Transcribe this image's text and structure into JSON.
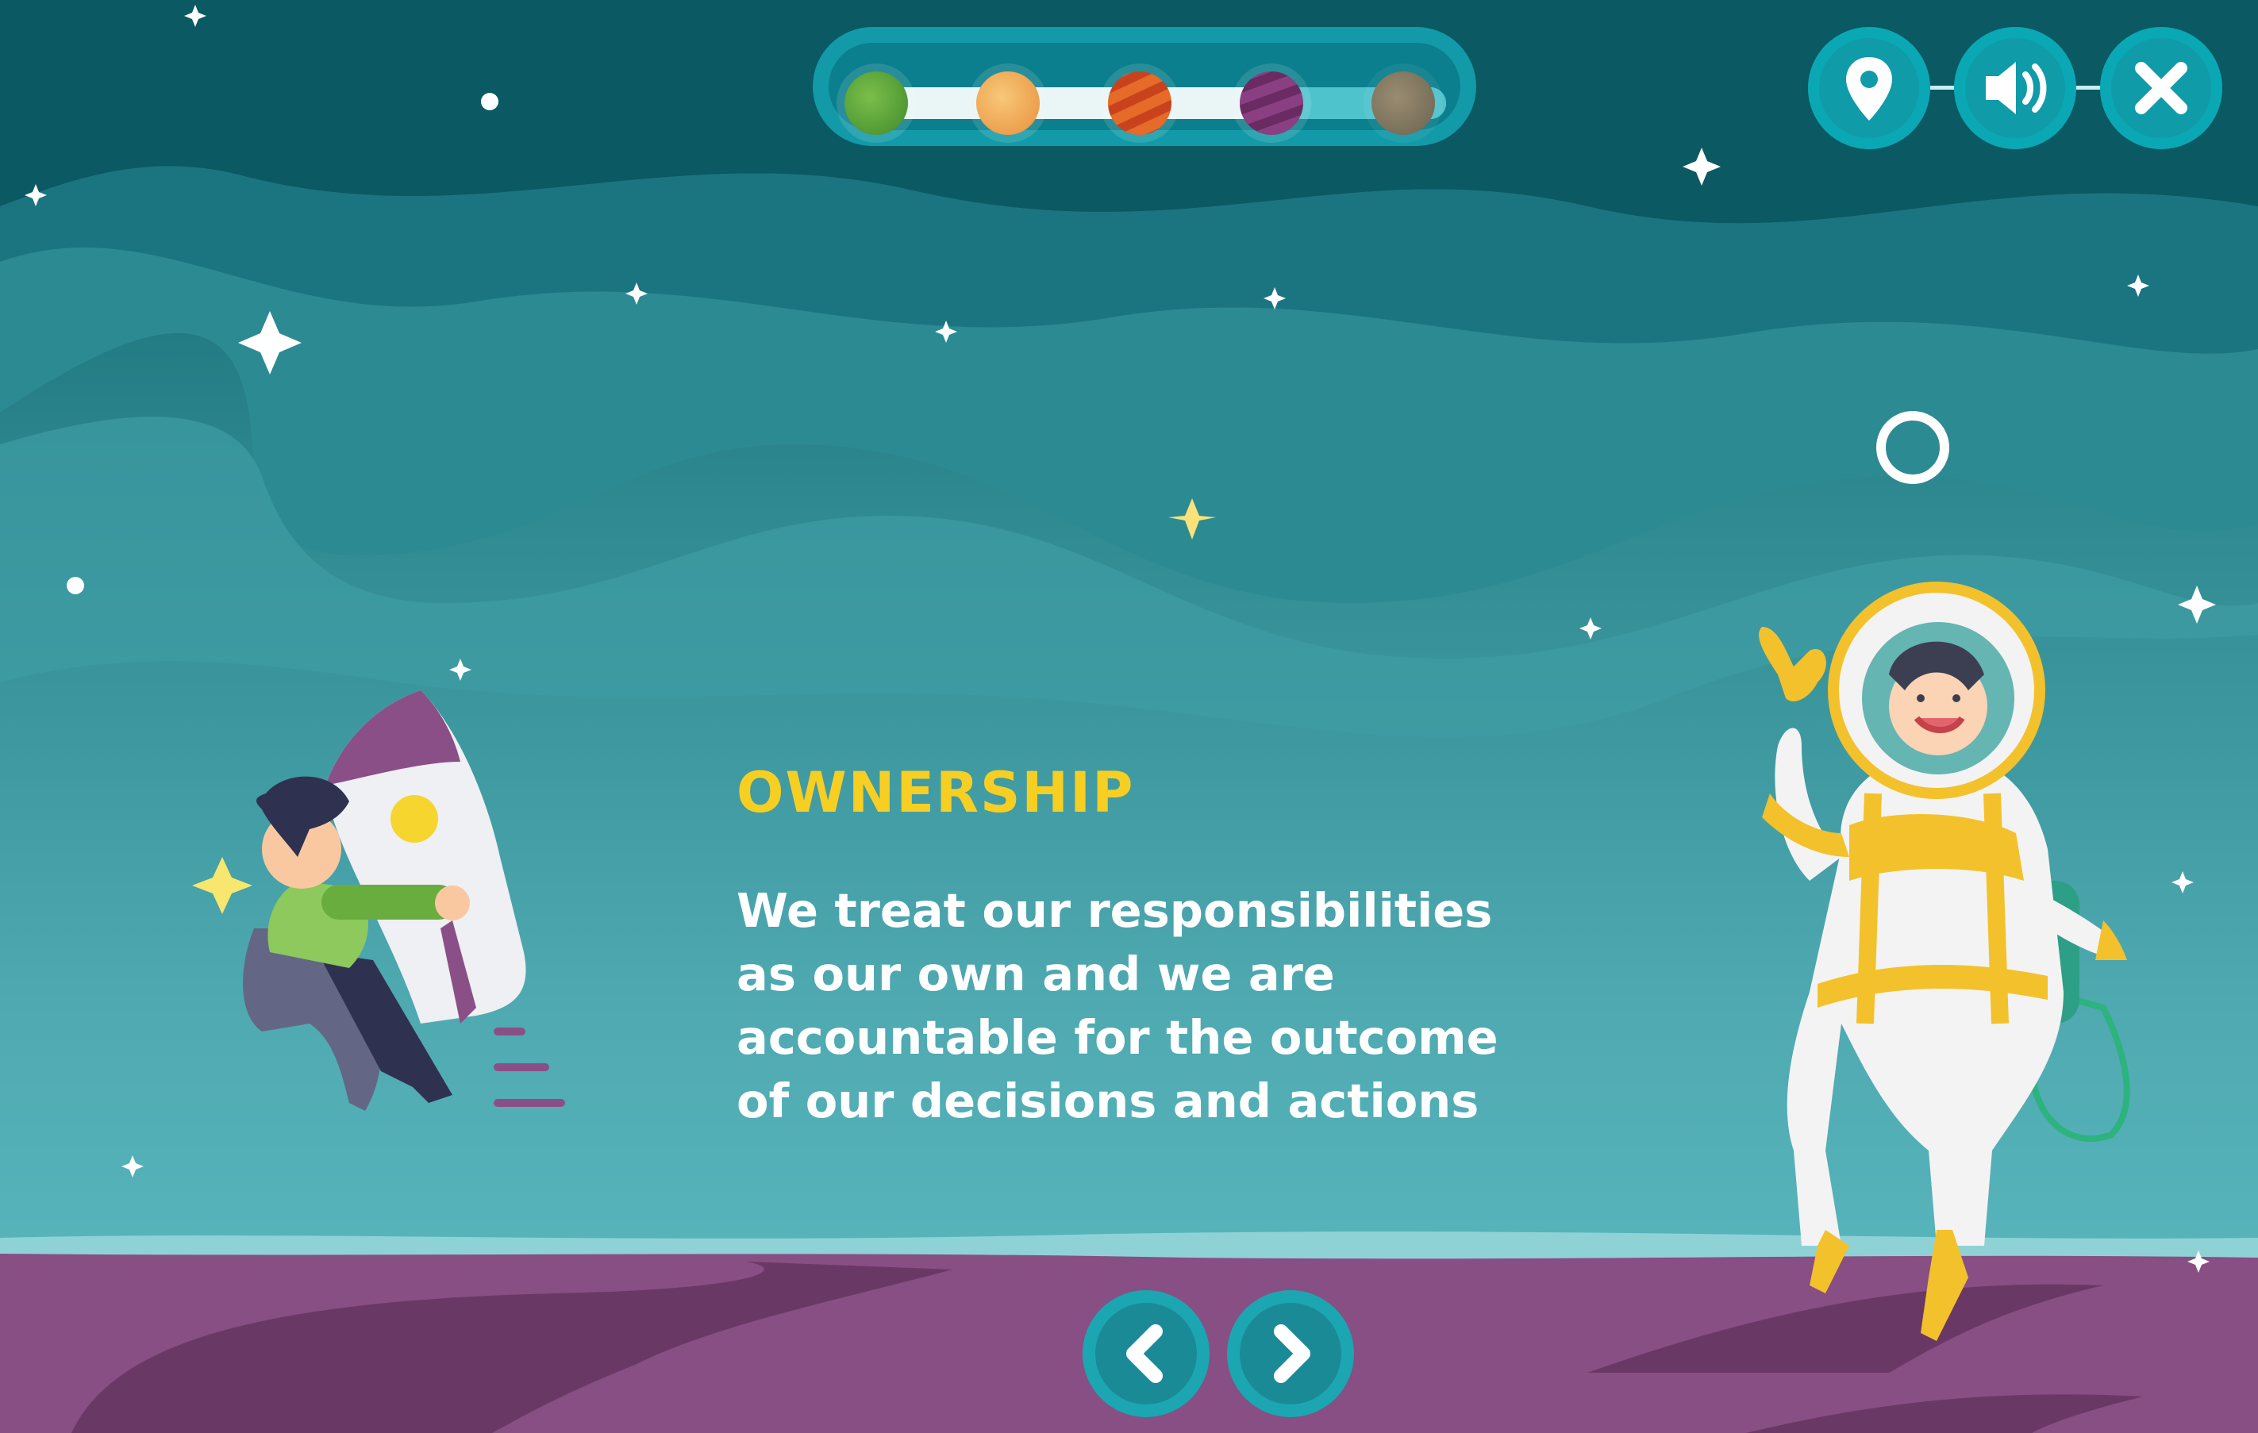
{
  "content": {
    "title": "OWNERSHIP",
    "description": "We treat our responsibilities as our own and we are accountable for the outcome of our decisions and actions"
  },
  "progress": {
    "planets": [
      "green-planet-icon",
      "ringed-planet-icon",
      "orange-planet-icon",
      "purple-planet-icon",
      "grey-planet-icon"
    ],
    "completed_fraction": 0.7
  },
  "controls": [
    "location-pin-icon",
    "speaker-volume-icon",
    "close-icon"
  ],
  "navigation": [
    "previous-arrow-icon",
    "next-arrow-icon"
  ],
  "colors": {
    "accent_yellow": "#f7cf22",
    "sky_dark": "#0d6470",
    "sky_light": "#5bb8bf",
    "ground_purple": "#874f83"
  }
}
